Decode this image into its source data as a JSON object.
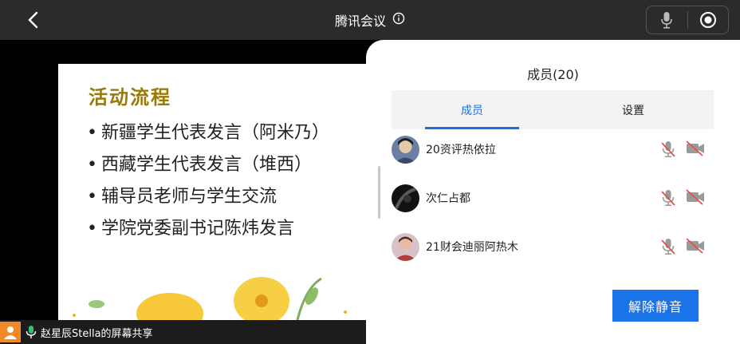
{
  "header": {
    "title": "腾讯会议"
  },
  "slide": {
    "title": "活动流程",
    "items": [
      "新疆学生代表发言（阿米乃）",
      "西藏学生代表发言（堆西）",
      "辅导员老师与学生交流",
      "学院党委副书记陈炜发言"
    ]
  },
  "share": {
    "label": "赵星辰Stella的屏幕共享"
  },
  "panel": {
    "title": "成员(20)",
    "tabs": [
      "成员",
      "设置"
    ],
    "members": [
      {
        "name": "20资评热依拉"
      },
      {
        "name": "次仁占都"
      },
      {
        "name": "21财会迪丽阿热木"
      }
    ],
    "unmute_button": "解除静音"
  },
  "colors": {
    "accent": "#1a73e8",
    "slide_title": "#9a7a06",
    "muted_red": "#e0534a"
  }
}
